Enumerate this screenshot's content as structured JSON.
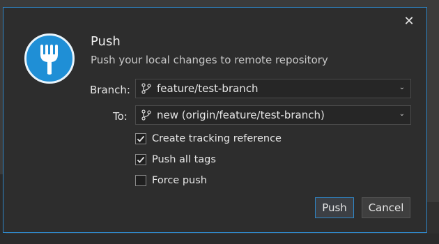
{
  "dialog": {
    "title": "Push",
    "subtitle": "Push your local changes to remote repository",
    "close_icon": "close-icon",
    "logo_icon": "fork-icon"
  },
  "form": {
    "branch_label": "Branch:",
    "branch_value": "feature/test-branch",
    "to_label": "To:",
    "to_value": "new (origin/feature/test-branch)",
    "dropdown_icon": "chevron-down-icon",
    "branch_icon": "git-branch-icon"
  },
  "options": [
    {
      "label": "Create tracking reference",
      "checked": true
    },
    {
      "label": "Push all tags",
      "checked": true
    },
    {
      "label": "Force push",
      "checked": false
    }
  ],
  "buttons": {
    "push": "Push",
    "cancel": "Cancel"
  },
  "colors": {
    "accent": "#2f86c7",
    "logo": "#1f8fd6",
    "dialog_bg": "#2d2d2d"
  }
}
